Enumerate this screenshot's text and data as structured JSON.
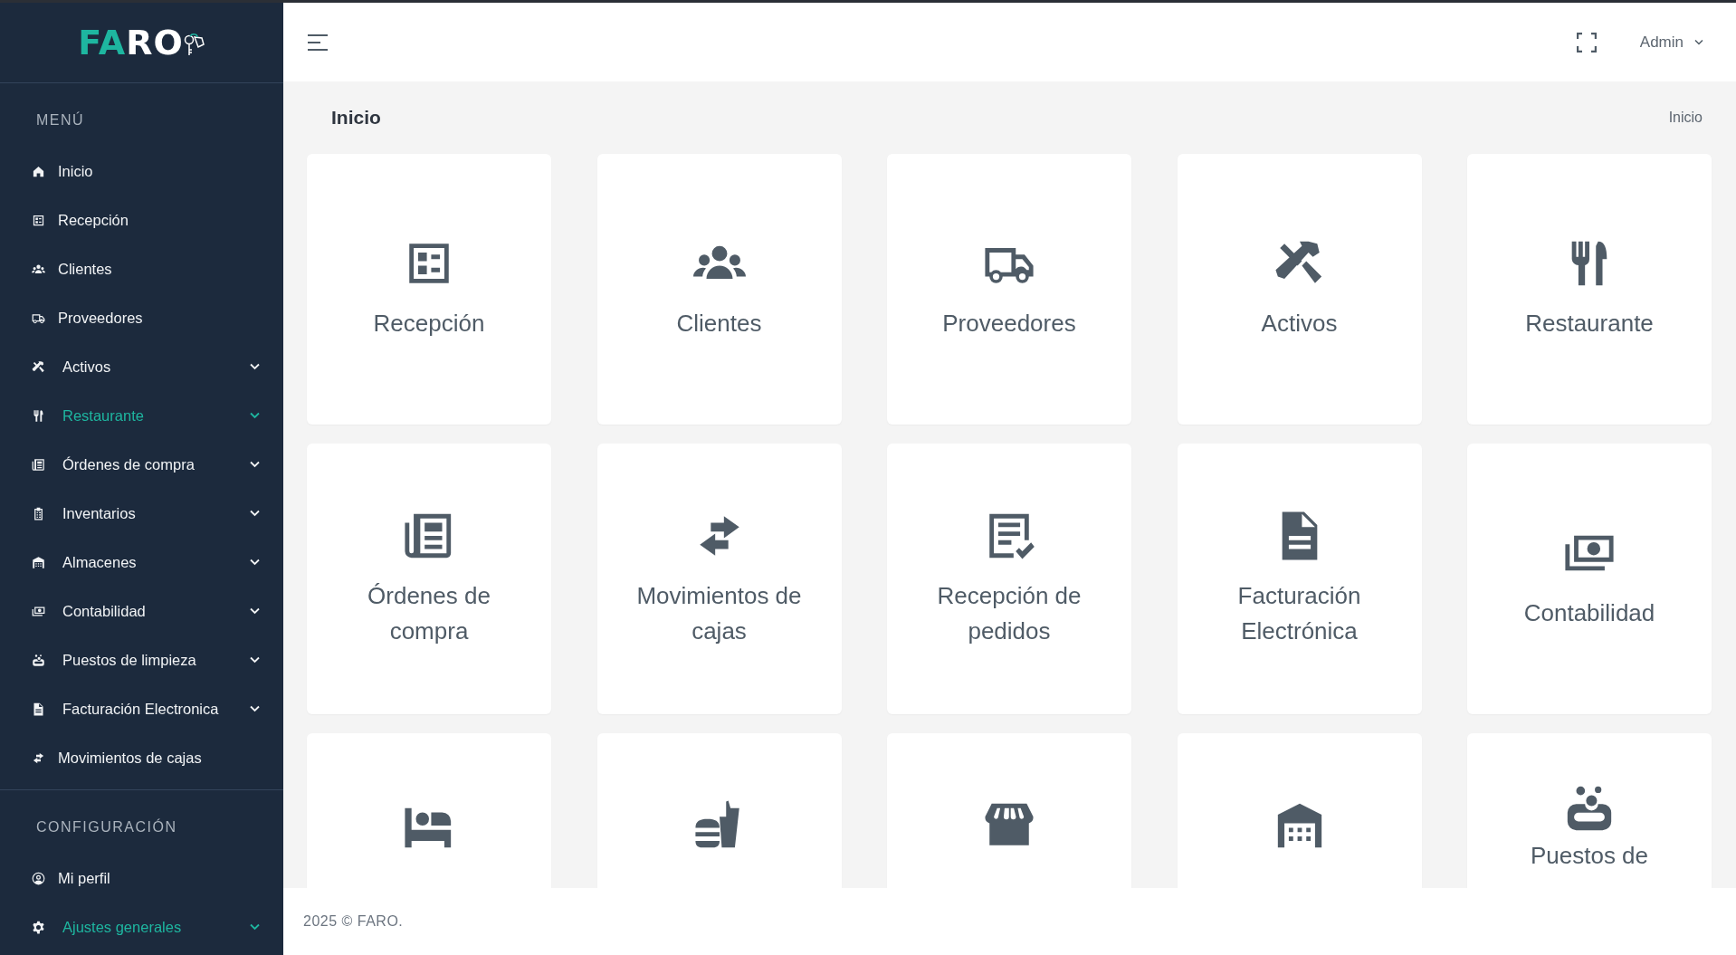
{
  "sidebar": {
    "logo": {
      "accent": "FA",
      "rest": "RO"
    },
    "sections": [
      {
        "title": "MENÚ",
        "items": [
          {
            "label": "Inicio",
            "expandable": false,
            "active": false
          },
          {
            "label": "Recepción",
            "expandable": false,
            "active": false
          },
          {
            "label": "Clientes",
            "expandable": false,
            "active": false
          },
          {
            "label": "Proveedores",
            "expandable": false,
            "active": false
          },
          {
            "label": "Activos",
            "expandable": true,
            "active": false
          },
          {
            "label": "Restaurante",
            "expandable": true,
            "active": true
          },
          {
            "label": "Órdenes de compra",
            "expandable": true,
            "active": false
          },
          {
            "label": "Inventarios",
            "expandable": true,
            "active": false
          },
          {
            "label": "Almacenes",
            "expandable": true,
            "active": false
          },
          {
            "label": "Contabilidad",
            "expandable": true,
            "active": false
          },
          {
            "label": "Puestos de limpieza",
            "expandable": true,
            "active": false
          },
          {
            "label": "Facturación Electronica",
            "expandable": true,
            "active": false
          },
          {
            "label": "Movimientos de cajas",
            "expandable": false,
            "active": false
          }
        ]
      },
      {
        "title": "CONFIGURACIÓN",
        "items": [
          {
            "label": "Mi perfil",
            "expandable": false,
            "active": false
          },
          {
            "label": "Ajustes generales",
            "expandable": true,
            "active": true
          }
        ]
      }
    ]
  },
  "header": {
    "user": "Admin"
  },
  "page": {
    "title": "Inicio",
    "breadcrumb": "Inicio"
  },
  "cards": [
    {
      "kind": "full",
      "label": "Recepción"
    },
    {
      "kind": "full",
      "label": "Clientes"
    },
    {
      "kind": "full",
      "label": "Proveedores"
    },
    {
      "kind": "full",
      "label": "Activos"
    },
    {
      "kind": "full",
      "label": "Restaurante"
    },
    {
      "kind": "full",
      "label": "Órdenes de compra"
    },
    {
      "kind": "full",
      "label": "Movimientos de cajas"
    },
    {
      "kind": "full",
      "label": "Recepción de pedidos"
    },
    {
      "kind": "full",
      "label": "Facturación Electrónica"
    },
    {
      "kind": "full",
      "label": "Contabilidad"
    },
    {
      "kind": "cut"
    },
    {
      "kind": "cut"
    },
    {
      "kind": "cut"
    },
    {
      "kind": "cut"
    },
    {
      "kind": "cut",
      "label": "Puestos de"
    }
  ],
  "footer": "2025 © FARO."
}
